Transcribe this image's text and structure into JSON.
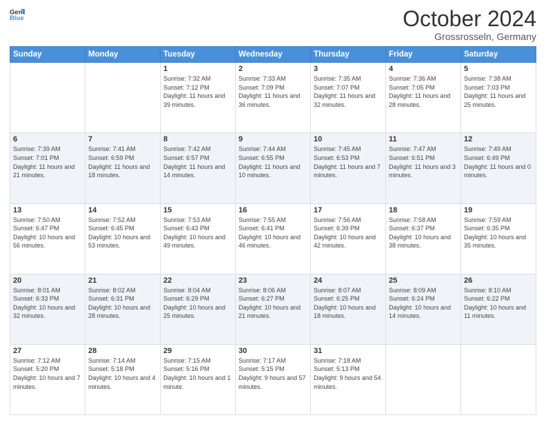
{
  "header": {
    "logo_line1": "General",
    "logo_line2": "Blue",
    "month": "October 2024",
    "location": "Grossrosseln, Germany"
  },
  "weekdays": [
    "Sunday",
    "Monday",
    "Tuesday",
    "Wednesday",
    "Thursday",
    "Friday",
    "Saturday"
  ],
  "weeks": [
    [
      {
        "day": "",
        "info": ""
      },
      {
        "day": "",
        "info": ""
      },
      {
        "day": "1",
        "info": "Sunrise: 7:32 AM\nSunset: 7:12 PM\nDaylight: 11 hours and 39 minutes."
      },
      {
        "day": "2",
        "info": "Sunrise: 7:33 AM\nSunset: 7:09 PM\nDaylight: 11 hours and 36 minutes."
      },
      {
        "day": "3",
        "info": "Sunrise: 7:35 AM\nSunset: 7:07 PM\nDaylight: 11 hours and 32 minutes."
      },
      {
        "day": "4",
        "info": "Sunrise: 7:36 AM\nSunset: 7:05 PM\nDaylight: 11 hours and 28 minutes."
      },
      {
        "day": "5",
        "info": "Sunrise: 7:38 AM\nSunset: 7:03 PM\nDaylight: 11 hours and 25 minutes."
      }
    ],
    [
      {
        "day": "6",
        "info": "Sunrise: 7:39 AM\nSunset: 7:01 PM\nDaylight: 11 hours and 21 minutes."
      },
      {
        "day": "7",
        "info": "Sunrise: 7:41 AM\nSunset: 6:59 PM\nDaylight: 11 hours and 18 minutes."
      },
      {
        "day": "8",
        "info": "Sunrise: 7:42 AM\nSunset: 6:57 PM\nDaylight: 11 hours and 14 minutes."
      },
      {
        "day": "9",
        "info": "Sunrise: 7:44 AM\nSunset: 6:55 PM\nDaylight: 11 hours and 10 minutes."
      },
      {
        "day": "10",
        "info": "Sunrise: 7:45 AM\nSunset: 6:53 PM\nDaylight: 11 hours and 7 minutes."
      },
      {
        "day": "11",
        "info": "Sunrise: 7:47 AM\nSunset: 6:51 PM\nDaylight: 11 hours and 3 minutes."
      },
      {
        "day": "12",
        "info": "Sunrise: 7:49 AM\nSunset: 6:49 PM\nDaylight: 11 hours and 0 minutes."
      }
    ],
    [
      {
        "day": "13",
        "info": "Sunrise: 7:50 AM\nSunset: 6:47 PM\nDaylight: 10 hours and 56 minutes."
      },
      {
        "day": "14",
        "info": "Sunrise: 7:52 AM\nSunset: 6:45 PM\nDaylight: 10 hours and 53 minutes."
      },
      {
        "day": "15",
        "info": "Sunrise: 7:53 AM\nSunset: 6:43 PM\nDaylight: 10 hours and 49 minutes."
      },
      {
        "day": "16",
        "info": "Sunrise: 7:55 AM\nSunset: 6:41 PM\nDaylight: 10 hours and 46 minutes."
      },
      {
        "day": "17",
        "info": "Sunrise: 7:56 AM\nSunset: 6:39 PM\nDaylight: 10 hours and 42 minutes."
      },
      {
        "day": "18",
        "info": "Sunrise: 7:58 AM\nSunset: 6:37 PM\nDaylight: 10 hours and 38 minutes."
      },
      {
        "day": "19",
        "info": "Sunrise: 7:59 AM\nSunset: 6:35 PM\nDaylight: 10 hours and 35 minutes."
      }
    ],
    [
      {
        "day": "20",
        "info": "Sunrise: 8:01 AM\nSunset: 6:33 PM\nDaylight: 10 hours and 32 minutes."
      },
      {
        "day": "21",
        "info": "Sunrise: 8:02 AM\nSunset: 6:31 PM\nDaylight: 10 hours and 28 minutes."
      },
      {
        "day": "22",
        "info": "Sunrise: 8:04 AM\nSunset: 6:29 PM\nDaylight: 10 hours and 25 minutes."
      },
      {
        "day": "23",
        "info": "Sunrise: 8:06 AM\nSunset: 6:27 PM\nDaylight: 10 hours and 21 minutes."
      },
      {
        "day": "24",
        "info": "Sunrise: 8:07 AM\nSunset: 6:25 PM\nDaylight: 10 hours and 18 minutes."
      },
      {
        "day": "25",
        "info": "Sunrise: 8:09 AM\nSunset: 6:24 PM\nDaylight: 10 hours and 14 minutes."
      },
      {
        "day": "26",
        "info": "Sunrise: 8:10 AM\nSunset: 6:22 PM\nDaylight: 10 hours and 11 minutes."
      }
    ],
    [
      {
        "day": "27",
        "info": "Sunrise: 7:12 AM\nSunset: 5:20 PM\nDaylight: 10 hours and 7 minutes."
      },
      {
        "day": "28",
        "info": "Sunrise: 7:14 AM\nSunset: 5:18 PM\nDaylight: 10 hours and 4 minutes."
      },
      {
        "day": "29",
        "info": "Sunrise: 7:15 AM\nSunset: 5:16 PM\nDaylight: 10 hours and 1 minute."
      },
      {
        "day": "30",
        "info": "Sunrise: 7:17 AM\nSunset: 5:15 PM\nDaylight: 9 hours and 57 minutes."
      },
      {
        "day": "31",
        "info": "Sunrise: 7:18 AM\nSunset: 5:13 PM\nDaylight: 9 hours and 54 minutes."
      },
      {
        "day": "",
        "info": ""
      },
      {
        "day": "",
        "info": ""
      }
    ]
  ]
}
